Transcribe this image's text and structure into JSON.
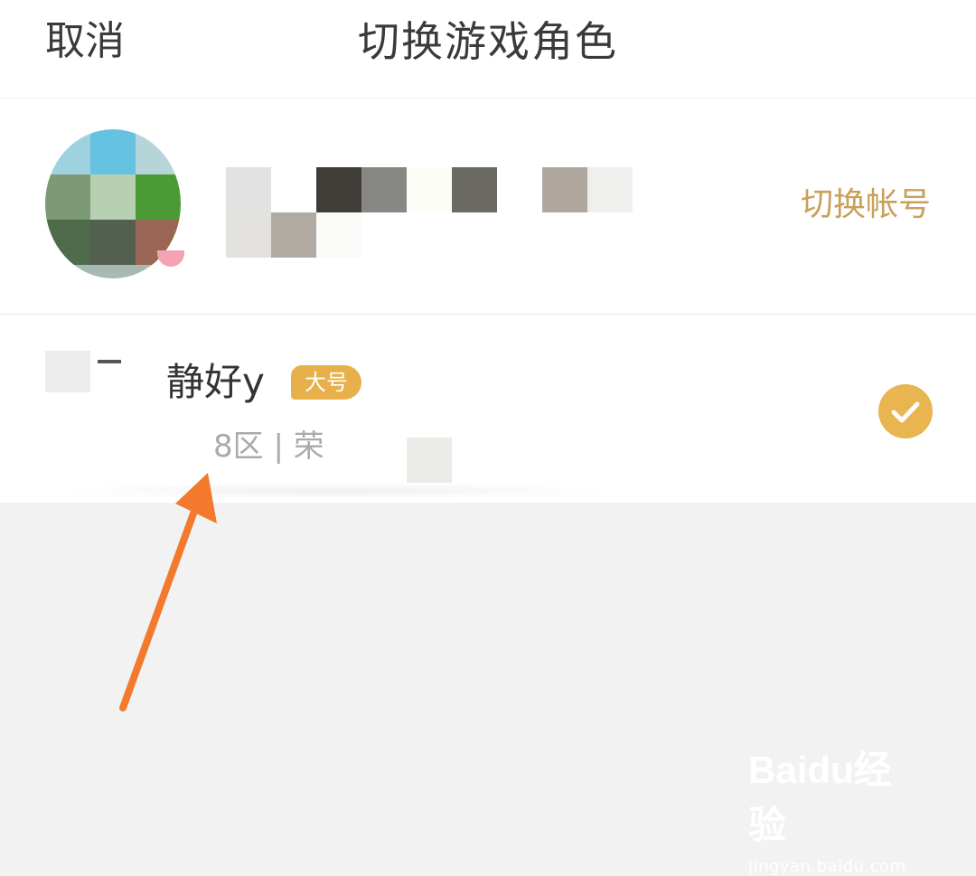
{
  "header": {
    "cancel_label": "取消",
    "title": "切换游戏角色"
  },
  "account": {
    "switch_label": "切换帐号"
  },
  "role": {
    "name": "静好y",
    "tag": "大号",
    "server": "8区 | 荣",
    "selected": true
  },
  "colors": {
    "accent": "#c8a15a",
    "badge": "#e8b04a",
    "check": "#e8b550",
    "arrow": "#f37a2c",
    "background": "#f2f2f2"
  },
  "watermark": {
    "logo": "Baidu经验",
    "url": "jingyan.baidu.com"
  },
  "icons": [
    "check-icon",
    "arrow-annotation-icon",
    "paw-logo-icon"
  ]
}
